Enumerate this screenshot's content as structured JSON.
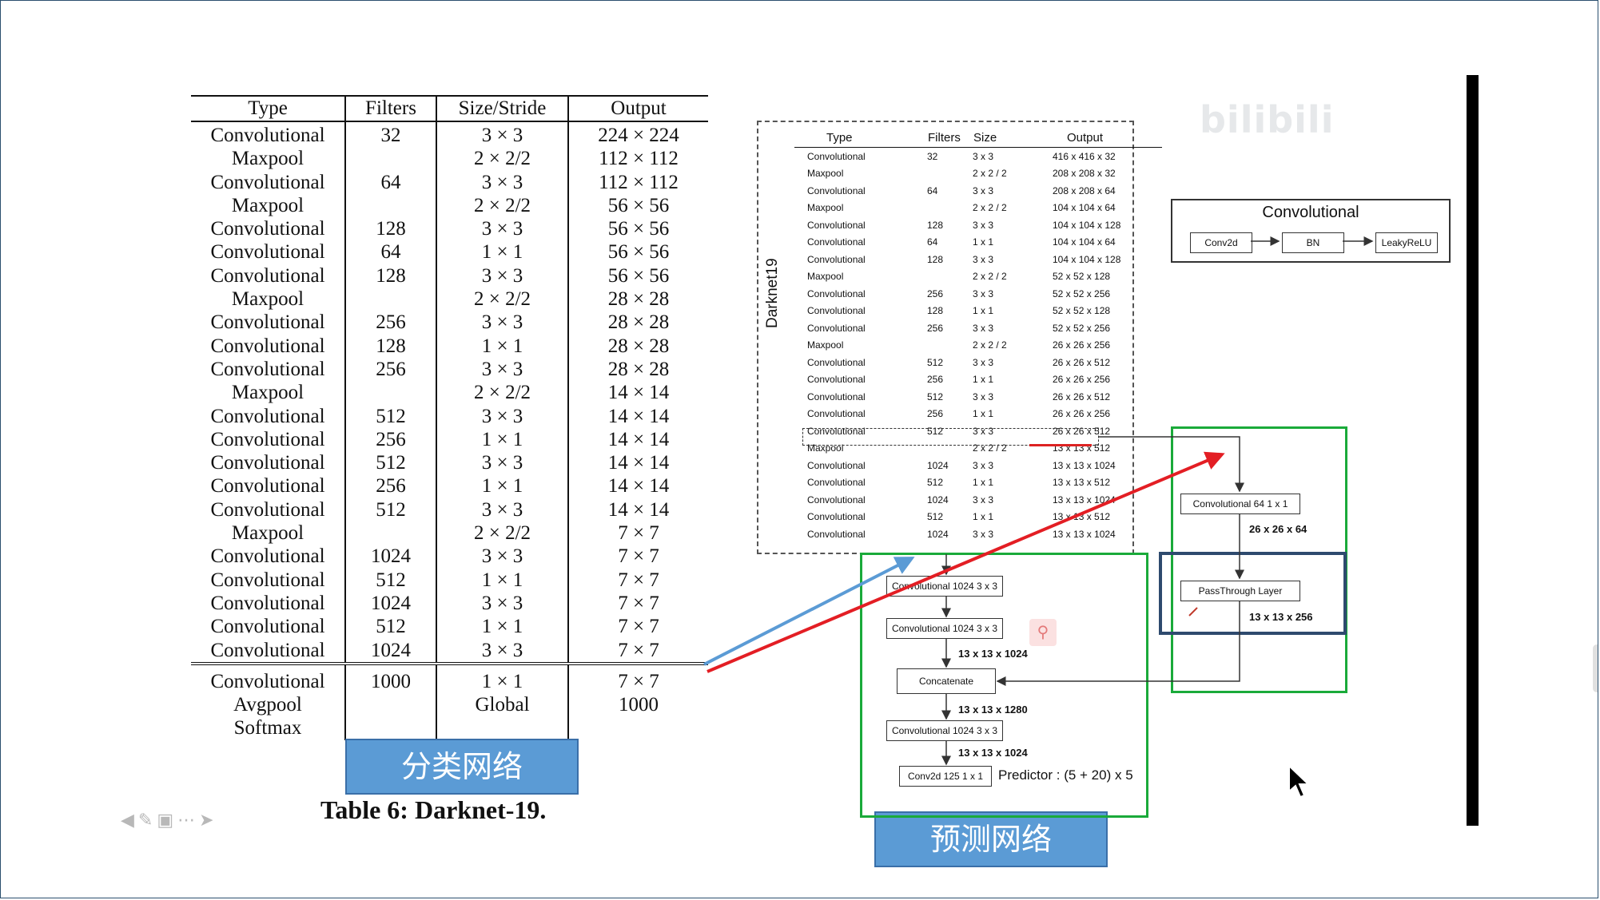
{
  "left_table": {
    "headers": [
      "Type",
      "Filters",
      "Size/Stride",
      "Output"
    ],
    "rows": [
      [
        "Convolutional",
        "32",
        "3 × 3",
        "224 × 224"
      ],
      [
        "Maxpool",
        "",
        "2 × 2/2",
        "112 × 112"
      ],
      [
        "Convolutional",
        "64",
        "3 × 3",
        "112 × 112"
      ],
      [
        "Maxpool",
        "",
        "2 × 2/2",
        "56 × 56"
      ],
      [
        "Convolutional",
        "128",
        "3 × 3",
        "56 × 56"
      ],
      [
        "Convolutional",
        "64",
        "1 × 1",
        "56 × 56"
      ],
      [
        "Convolutional",
        "128",
        "3 × 3",
        "56 × 56"
      ],
      [
        "Maxpool",
        "",
        "2 × 2/2",
        "28 × 28"
      ],
      [
        "Convolutional",
        "256",
        "3 × 3",
        "28 × 28"
      ],
      [
        "Convolutional",
        "128",
        "1 × 1",
        "28 × 28"
      ],
      [
        "Convolutional",
        "256",
        "3 × 3",
        "28 × 28"
      ],
      [
        "Maxpool",
        "",
        "2 × 2/2",
        "14 × 14"
      ],
      [
        "Convolutional",
        "512",
        "3 × 3",
        "14 × 14"
      ],
      [
        "Convolutional",
        "256",
        "1 × 1",
        "14 × 14"
      ],
      [
        "Convolutional",
        "512",
        "3 × 3",
        "14 × 14"
      ],
      [
        "Convolutional",
        "256",
        "1 × 1",
        "14 × 14"
      ],
      [
        "Convolutional",
        "512",
        "3 × 3",
        "14 × 14"
      ],
      [
        "Maxpool",
        "",
        "2 × 2/2",
        "7 × 7"
      ],
      [
        "Convolutional",
        "1024",
        "3 × 3",
        "7 × 7"
      ],
      [
        "Convolutional",
        "512",
        "1 × 1",
        "7 × 7"
      ],
      [
        "Convolutional",
        "1024",
        "3 × 3",
        "7 × 7"
      ],
      [
        "Convolutional",
        "512",
        "1 × 1",
        "7 × 7"
      ],
      [
        "Convolutional",
        "1024",
        "3 × 3",
        "7 × 7"
      ]
    ],
    "tail_rows": [
      [
        "Convolutional",
        "1000",
        "1 × 1",
        "7 × 7"
      ],
      [
        "Avgpool",
        "",
        "Global",
        "1000"
      ],
      [
        "Softmax",
        "",
        "",
        ""
      ]
    ],
    "caption": "Table 6: Darknet-19."
  },
  "tags": {
    "classify": "分类网络",
    "predict": "预测网络"
  },
  "darknet_table": {
    "label": "Darknet19",
    "headers": [
      "Type",
      "Filters",
      "Size",
      "Output"
    ],
    "rows": [
      [
        "Convolutional",
        "32",
        "3 x 3",
        "416 x 416 x 32"
      ],
      [
        "Maxpool",
        "",
        "2 x 2 / 2",
        "208 x 208 x 32"
      ],
      [
        "Convolutional",
        "64",
        "3 x 3",
        "208 x 208 x 64"
      ],
      [
        "Maxpool",
        "",
        "2 x 2 / 2",
        "104 x 104 x 64"
      ],
      [
        "Convolutional",
        "128",
        "3 x 3",
        "104 x 104 x 128"
      ],
      [
        "Convolutional",
        "64",
        "1 x 1",
        "104 x 104 x 64"
      ],
      [
        "Convolutional",
        "128",
        "3 x 3",
        "104 x 104 x 128"
      ],
      [
        "Maxpool",
        "",
        "2 x 2 / 2",
        "52 x 52 x 128"
      ],
      [
        "Convolutional",
        "256",
        "3 x 3",
        "52 x 52 x 256"
      ],
      [
        "Convolutional",
        "128",
        "1 x 1",
        "52 x 52 x 128"
      ],
      [
        "Convolutional",
        "256",
        "3 x 3",
        "52 x 52 x 256"
      ],
      [
        "Maxpool",
        "",
        "2 x 2 / 2",
        "26 x 26 x 256"
      ],
      [
        "Convolutional",
        "512",
        "3 x 3",
        "26 x 26 x 512"
      ],
      [
        "Convolutional",
        "256",
        "1 x 1",
        "26 x 26 x 256"
      ],
      [
        "Convolutional",
        "512",
        "3 x 3",
        "26 x 26 x 512"
      ],
      [
        "Convolutional",
        "256",
        "1 x 1",
        "26 x 26 x 256"
      ],
      [
        "Convolutional",
        "512",
        "3 x 3",
        "26 x 26 x 512"
      ],
      [
        "Maxpool",
        "",
        "2 x 2 / 2",
        "13 x 13 x 512"
      ],
      [
        "Convolutional",
        "1024",
        "3 x 3",
        "13 x 13 x 1024"
      ],
      [
        "Convolutional",
        "512",
        "1 x 1",
        "13 x 13 x 512"
      ],
      [
        "Convolutional",
        "1024",
        "3 x 3",
        "13 x 13 x 1024"
      ],
      [
        "Convolutional",
        "512",
        "1 x 1",
        "13 x 13 x 512"
      ],
      [
        "Convolutional",
        "1024",
        "3 x 3",
        "13 x 13 x 1024"
      ]
    ]
  },
  "conv_block": {
    "title": "Convolutional",
    "nodes": [
      "Conv2d",
      "BN",
      "LeakyReLU"
    ]
  },
  "predict_flow": {
    "conv1": "Convolutional   1024  3 x 3",
    "conv2": "Convolutional   1024  3 x 3",
    "dim1": "13 x 13 x 1024",
    "concat": "Concatenate",
    "dim2": "13 x 13 x 1280",
    "conv3": "Convolutional   1024  3 x 3",
    "dim3": "13 x 13 x 1024",
    "conv2d": "Conv2d   125  1 x 1",
    "predictor": "Predictor : (5 + 20) x 5"
  },
  "passthrough_flow": {
    "conv": "Convolutional  64   1 x 1",
    "dim1": "26 x 26 x 64",
    "passthrough": "PassThrough Layer",
    "dim2": "13 x 13 x 256"
  },
  "watermark": "bilibili",
  "colors": {
    "tag_fill": "#5b9bd5",
    "green": "#1aaa3a",
    "navy": "#2e4a6e",
    "red_arrow": "#e31e24",
    "blue_arrow": "#5b9bd5"
  }
}
